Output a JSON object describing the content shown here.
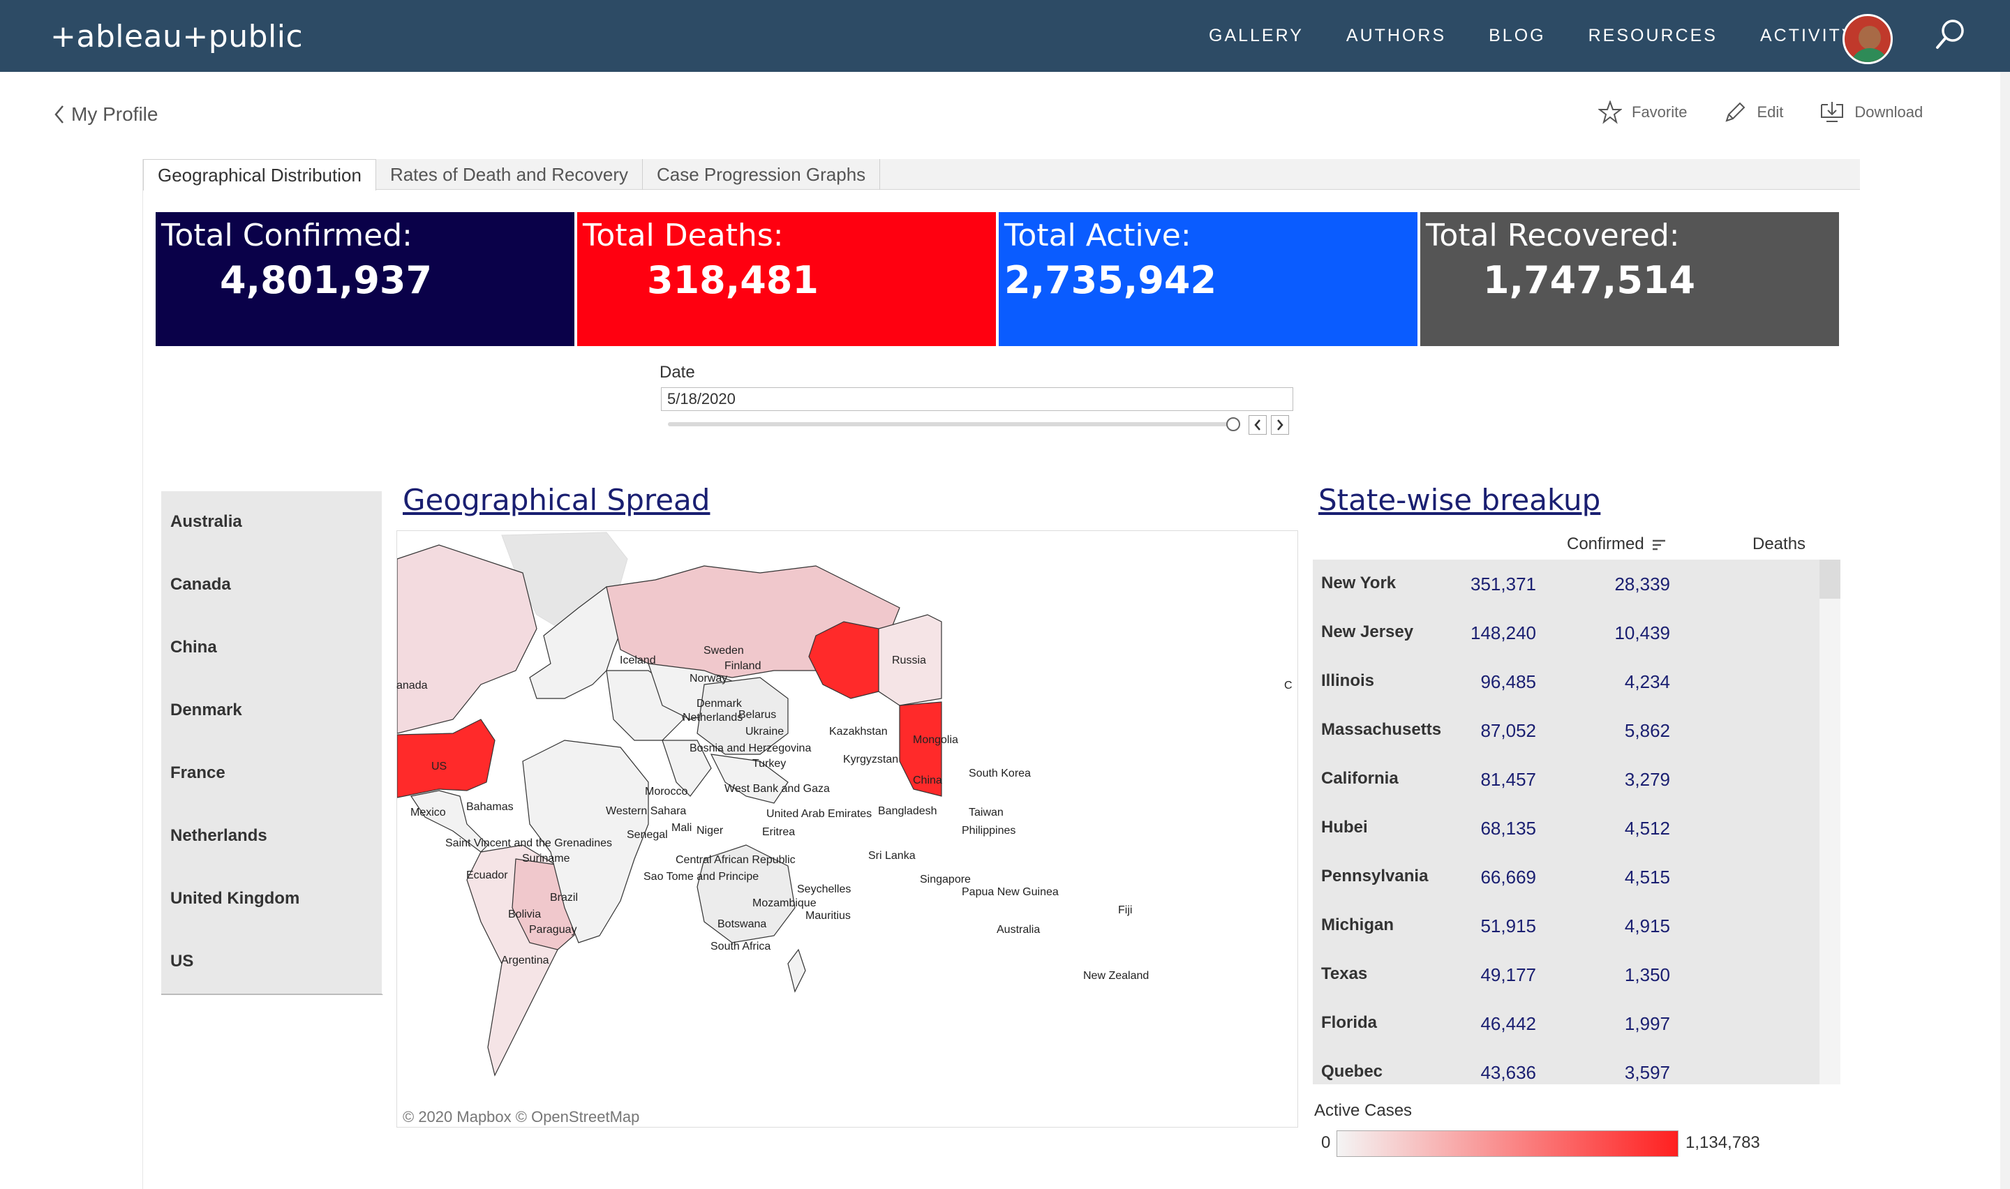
{
  "topbar": {
    "logo": "+ableau+public",
    "nav": [
      "GALLERY",
      "AUTHORS",
      "BLOG",
      "RESOURCES",
      "ACTIVITY"
    ]
  },
  "subheader": {
    "back_label": "My Profile",
    "actions": [
      "Favorite",
      "Edit",
      "Download"
    ]
  },
  "tabs": [
    "Geographical Distribution",
    "Rates of Death and Recovery",
    "Case Progression Graphs"
  ],
  "kpis": [
    {
      "label": "Total Confirmed:",
      "value": "4,801,937",
      "color": "#0a0149"
    },
    {
      "label": "Total Deaths:",
      "value": "318,481",
      "color": "#ff0010"
    },
    {
      "label": "Total Active:",
      "value": "2,735,942",
      "color": "#0a5cff"
    },
    {
      "label": "Total Recovered:",
      "value": "1,747,514",
      "color": "#555555"
    }
  ],
  "date_filter": {
    "label": "Date",
    "value": "5/18/2020"
  },
  "countries": [
    "Australia",
    "Canada",
    "China",
    "Denmark",
    "France",
    "Netherlands",
    "United Kingdom",
    "US"
  ],
  "map": {
    "title": "Geographical Spread",
    "attribution": "© 2020 Mapbox  © OpenStreetMap",
    "labels": [
      "Russia",
      "US",
      "China",
      "Brazil",
      "Australia",
      "Kazakhstan",
      "Mongolia",
      "Kyrgyzstan",
      "Iceland",
      "Sweden",
      "Finland",
      "Norway",
      "Denmark",
      "Netherlands",
      "Belarus",
      "Ukraine",
      "Bosnia and Herzegovina",
      "Turkey",
      "Morocco",
      "West Bank and Gaza",
      "Western Sahara",
      "United Arab Emirates",
      "Bangladesh",
      "Taiwan",
      "South Korea",
      "Philippines",
      "Mali",
      "Niger",
      "Eritrea",
      "Senegal",
      "Central African Republic",
      "Sao Tome and Principe",
      "Sri Lanka",
      "Singapore",
      "Seychelles",
      "Papua New Guinea",
      "Mozambique",
      "Mauritius",
      "Botswana",
      "South Africa",
      "Fiji",
      "New Zealand",
      "Mexico",
      "Bahamas",
      "Saint Vincent and the Grenadines",
      "Ecuador",
      "Suriname",
      "Bolivia",
      "Paraguay",
      "Argentina",
      "anada",
      "C"
    ],
    "highlight_colors": {
      "high": "#ff2a2a",
      "medium": "#f0c8cc",
      "low": "#f2f2f2"
    }
  },
  "table": {
    "title": "State-wise breakup",
    "headers": [
      "Confirmed",
      "Deaths"
    ],
    "rows": [
      {
        "state": "New York",
        "confirmed": "351,371",
        "deaths": "28,339"
      },
      {
        "state": "New Jersey",
        "confirmed": "148,240",
        "deaths": "10,439"
      },
      {
        "state": "Illinois",
        "confirmed": "96,485",
        "deaths": "4,234"
      },
      {
        "state": "Massachusetts",
        "confirmed": "87,052",
        "deaths": "5,862"
      },
      {
        "state": "California",
        "confirmed": "81,457",
        "deaths": "3,279"
      },
      {
        "state": "Hubei",
        "confirmed": "68,135",
        "deaths": "4,512"
      },
      {
        "state": "Pennsylvania",
        "confirmed": "66,669",
        "deaths": "4,515"
      },
      {
        "state": "Michigan",
        "confirmed": "51,915",
        "deaths": "4,915"
      },
      {
        "state": "Texas",
        "confirmed": "49,177",
        "deaths": "1,350"
      },
      {
        "state": "Florida",
        "confirmed": "46,442",
        "deaths": "1,997"
      },
      {
        "state": "Quebec",
        "confirmed": "43,636",
        "deaths": "3,597"
      }
    ]
  },
  "legend": {
    "title": "Active Cases",
    "min": "0",
    "max": "1,134,783"
  }
}
